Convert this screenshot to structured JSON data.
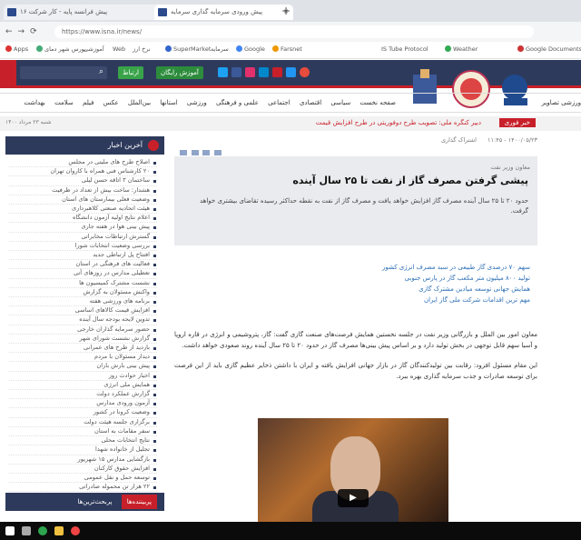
{
  "browser": {
    "tabs": [
      {
        "title": "پیش فرانسه پایه - کار شرکت ۱۶"
      },
      {
        "title": "پیش ورودی سرمایه گذاری سرمایه"
      }
    ],
    "url": "https://www.isna.ir/news/"
  },
  "bookmarks": [
    "Apps",
    "بورس شهر دمای",
    "آموزشی",
    "Web",
    "نرخ ارز",
    "SuperMarket",
    "سرمایه",
    "Google",
    "Farsnet",
    "IS Tube Protocol",
    "Weather",
    "Google Documents"
  ],
  "header": {
    "button_label": "آموزش رایگان",
    "contact_label": "ارتباط",
    "social_colors": [
      "#1da1f2",
      "#3b5998",
      "#e1306c",
      "#0088cc",
      "#c8202a",
      "#2196f3"
    ]
  },
  "nav": {
    "items": [
      "صفحه نخست",
      "سیاسی",
      "اقتصادی",
      "اجتماعی",
      "علمی و فرهنگی",
      "ورزشی",
      "استانها",
      "بین‌الملل",
      "عکس",
      "فیلم",
      "سلامت",
      "بهداشت",
      "ورزشی",
      "تصاویر"
    ]
  },
  "ticker": {
    "label": "خبر فوری",
    "text": "دبیر کنگره ملی: تصویب طرح دوفوریتی در طرح افزایش قیمت",
    "date": "شنبه ۲۳ مرداد ۱۴۰۰"
  },
  "sidebar": {
    "title": "آخرین اخبار",
    "items": [
      "اصلاح طرح های ملیتی در مجلس",
      "۲۰ کارشناس فنی همراه با کاروان تهران",
      "ساختمان ۳ اتاقه حسن لیلی",
      "هشدار: ساخت بیش از تعداد در ظرفیت",
      "وضعیت فعلی بیمارستان های استان",
      "هیئت اتحادیه صنعتی کلاهبرداری",
      "اعلام نتایج اولیه آزمون دانشگاه",
      "پیش بینی هوا در هفته جاری",
      "گسترش ارتباطات مخابراتی",
      "بررسی وضعیت انتخابات شورا",
      "افتتاح پل ارتباطی جدید",
      "فعالیت های فرهنگی در استان",
      "تعطیلی مدارس در روزهای آتی",
      "نشست مشترک کمیسیون ها",
      "واکنش مسئولان به گزارش",
      "برنامه های ورزشی هفته",
      "افزایش قیمت کالاهای اساسی",
      "تدوین لایحه بودجه سال آینده",
      "حضور سرمایه گذاران خارجی",
      "گزارش نشست شورای شهر",
      "بازدید از طرح های عمرانی",
      "دیدار مسئولان با مردم",
      "پیش بینی بارش باران",
      "اخبار حوادث روز",
      "همایش ملی انرژی",
      "گزارش عملکرد دولت",
      "آزمون ورودی مدارس",
      "وضعیت کرونا در کشور",
      "برگزاری جلسه هیئت دولت",
      "سفر مقامات به استان",
      "نتایج انتخابات محلی",
      "تجلیل از خانواده شهدا",
      "بازگشایی مدارس ۱۵ شهریور",
      "افزایش حقوق کارکنان",
      "توسعه حمل و نقل عمومی",
      "۲۲ هزار تن محموله صادراتی",
      "۲ روز تعطیلی در ۲۳ استان"
    ],
    "footer_tabs": [
      "پربیننده‌ها",
      "پربحث‌ترین‌ها"
    ]
  },
  "article": {
    "meta": "۱۴۰۰/۰۵/۲۳ - ۱۱:۴۵",
    "share_label": "اشتراک گذاری",
    "supertitle": "معاون وزیر نفت",
    "headline": "پیشی گرفتن مصرف گاز از نفت تا ۲۵ سال آینده",
    "lead": "حدود ۲۰ تا ۲۵ سال آینده مصرف گاز افزایش خواهد یافت و مصرف گاز از نفت به نقطه حداکثر رسیده تقاضای بیشتری خواهد گرفت.",
    "related": [
      "سهم ۷۰ درصدی گاز طبیعی در سبد مصرف انرژی کشور",
      "تولید ۸۰۰ میلیون متر مکعب گاز در پارس جنوبی",
      "همایش جهانی توسعه میادین مشترک گازی",
      "مهم ترین اقدامات شرکت ملی گاز ایران"
    ],
    "paragraphs": [
      "معاون امور بین الملل و بازرگانی وزیر نفت در جلسه نخستین همایش فرصت‌های صنعت گازی گفت: گاز، پتروشیمی و انرژی در قاره اروپا و آسیا سهم قابل توجهی در بخش تولید دارد و بر اساس پیش بینی‌ها مصرف گاز در حدود ۲۰ تا ۲۵ سال آینده روند صعودی خواهد داشت.",
      "این مقام مسئول افزود: رقابت بین تولیدکنندگان گاز در بازار جهانی افزایش یافته و ایران با داشتن ذخایر عظیم گازی باید از این فرصت برای توسعه صادرات و جذب سرمایه گذاری بهره ببرد."
    ]
  }
}
